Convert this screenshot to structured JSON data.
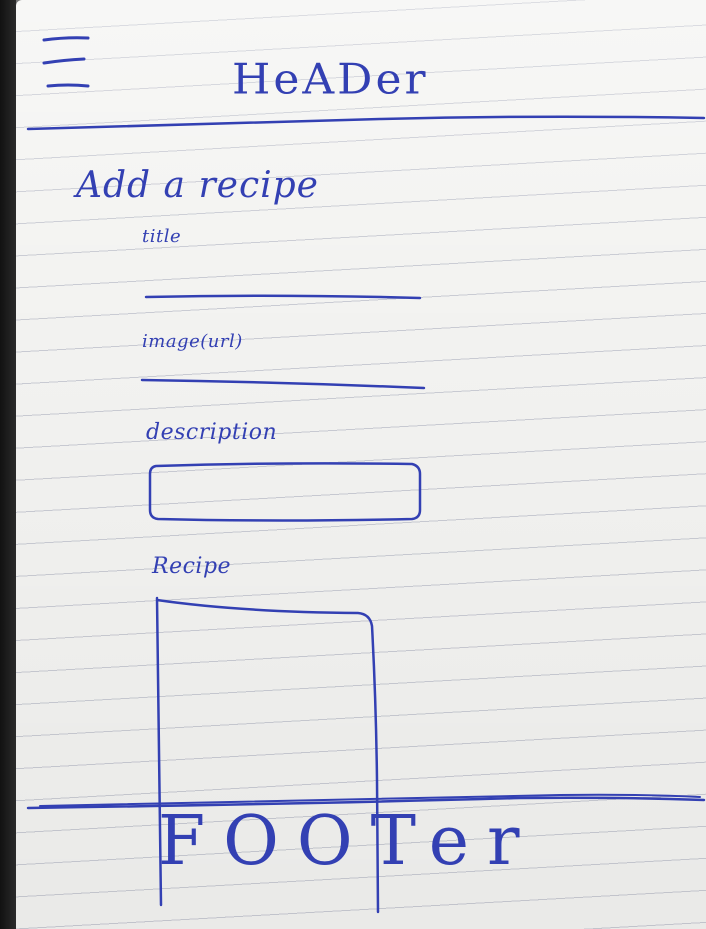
{
  "header": {
    "title": "HeADer"
  },
  "form": {
    "title": "Add a recipe",
    "fields": [
      {
        "label": "title"
      },
      {
        "label": "image(url)"
      },
      {
        "label": "description"
      },
      {
        "label": "Recipe"
      }
    ]
  },
  "footer": {
    "title": "FOOTer"
  },
  "colors": {
    "ink": "#3340b3",
    "paper": "#f3f3f1",
    "rule_lines": "#c9cbd3"
  },
  "icons": {
    "menu": "hamburger-menu-icon"
  }
}
